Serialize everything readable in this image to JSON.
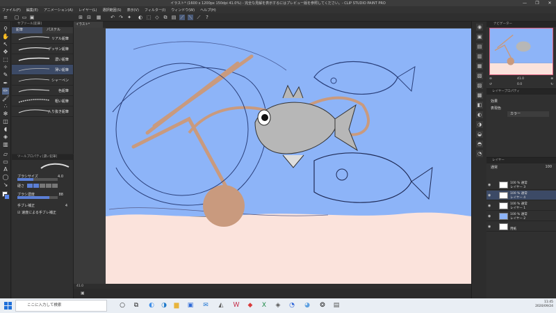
{
  "window": {
    "title": "イラスト* (1600 x 1200px 150dpi 41.0%)  - 完全な見解を表示するにはプレビュー版を参照してください。- CLIP STUDIO PAINT PRO",
    "controls": [
      "—",
      "❐",
      "✕"
    ]
  },
  "menu": [
    "ファイル(F)",
    "編集(E)",
    "アニメーション(A)",
    "レイヤー(L)",
    "選択範囲(S)",
    "表示(V)",
    "フィルター(I)",
    "ウィンドウ(W)",
    "ヘルプ(H)"
  ],
  "document_tab": "イラスト*",
  "subtool_panel": {
    "header": "サブツール[鉛筆]",
    "tabs": [
      "鉛筆",
      "パステル"
    ],
    "brushes": [
      {
        "label": "リアル鉛筆"
      },
      {
        "label": "デッサン鉛筆"
      },
      {
        "label": "濃い鉛筆"
      },
      {
        "label": "薄い鉛筆"
      },
      {
        "label": "シャーペン"
      },
      {
        "label": "色鉛筆"
      },
      {
        "label": "粗い鉛筆"
      },
      {
        "label": "入り抜き鉛筆"
      }
    ]
  },
  "tool_property": {
    "header": "ツールプロパティ[濃い鉛筆]",
    "brush_size_label": "ブラシサイズ",
    "brush_size_value": "4.0",
    "hardness_label": "硬さ",
    "density_label": "ブラシ濃度",
    "density_value": "88",
    "stabilization_label": "手ブレ補正",
    "stabilization_value": "4",
    "speed_label": "速度による手ブレ補正"
  },
  "navigator": {
    "header": "ナビゲーター",
    "zoom": "41.0",
    "rotation": "0.0"
  },
  "layer_property": {
    "header": "レイヤープロパティ",
    "effect_label": "効果",
    "expression_label": "表現色",
    "expression_value": "カラー"
  },
  "layer_panel": {
    "header": "レイヤー",
    "blend_mode": "通常",
    "opacity": "100",
    "layers": [
      {
        "line1": "100 % 通常",
        "line2": "レイヤー 3"
      },
      {
        "line1": "100 % 通常",
        "line2": "レイヤー 4"
      },
      {
        "line1": "100 % 通常",
        "line2": "レイヤー 1"
      },
      {
        "line1": "100 % 通常",
        "line2": "レイヤー 2"
      },
      {
        "line1": "",
        "line2": "用紙"
      }
    ]
  },
  "canvas_status": {
    "zoom": "41.0",
    "angle": "0.0"
  },
  "taskbar": {
    "search_placeholder": "ここに入力して検索",
    "time": "11:45",
    "date": "2020/09/24"
  },
  "colors": {
    "sky": "#8db4f8",
    "sand": "#fbe3dc",
    "fish": "#b7b7b7",
    "rock": "#c99a7e",
    "accent": "#55688c"
  }
}
